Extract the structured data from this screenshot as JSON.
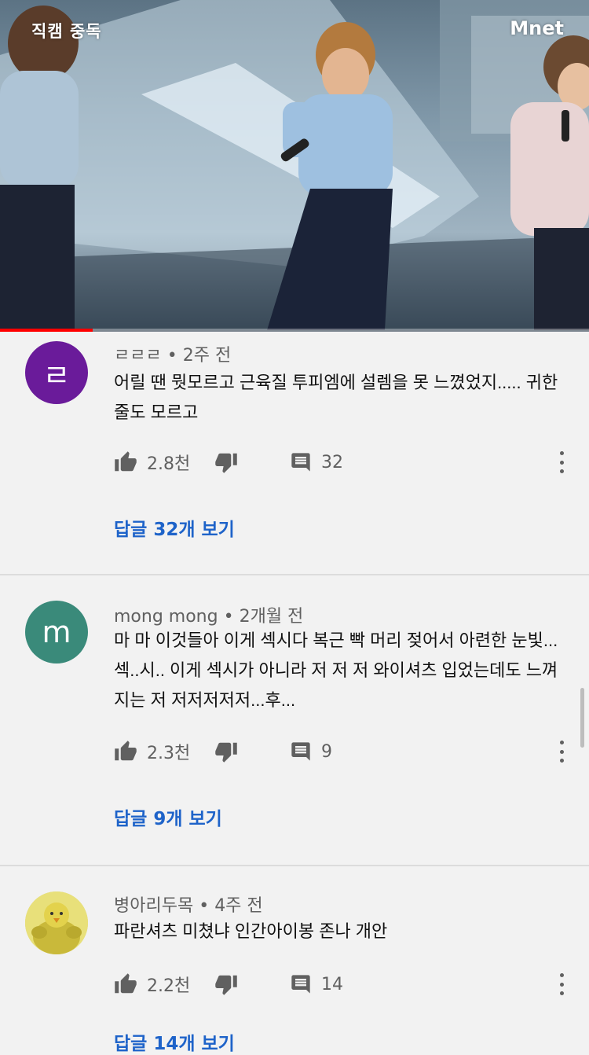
{
  "video": {
    "watermark_left": "직캠 중독",
    "watermark_right": "Mnet",
    "progress": 0.157
  },
  "colors": {
    "accent_link": "#1e63c9",
    "progress": "#ff0000",
    "avatar1": "#6a1b9a",
    "avatar2": "#3a8a7a"
  },
  "comments": [
    {
      "author": "ㄹㄹㄹ",
      "time": "2주 전",
      "avatar_letter": "ㄹ",
      "text": "어릴 땐 뭣모르고 근육질 투피엠에 설렘을 못 느꼈었지..... 귀한 줄도 모르고",
      "likes": "2.8천",
      "reply_count": "32",
      "view_replies": "답글 32개 보기"
    },
    {
      "author": "mong mong",
      "time": "2개월 전",
      "avatar_letter": "m",
      "text": "마 마 이것들아 이게 섹시다  복근 빡 머리 젖어서 아련한 눈빛... 섹..시.. 이게 섹시가 아니라 저 저 저 와이셔츠 입었는데도 느껴지는 저 저저저저저...후...",
      "likes": "2.3천",
      "reply_count": "9",
      "view_replies": "답글 9개 보기"
    },
    {
      "author": "병아리두목",
      "time": "4주 전",
      "avatar_letter": "",
      "text": "파란셔츠 미쳤냐 인간아이봉 존나 개안",
      "likes": "2.2천",
      "reply_count": "14",
      "view_replies": "답글 14개 보기"
    }
  ],
  "icons": {
    "like": "thumb-up-icon",
    "dislike": "thumb-down-icon",
    "reply": "comment-icon",
    "more": "more-vertical-icon"
  }
}
